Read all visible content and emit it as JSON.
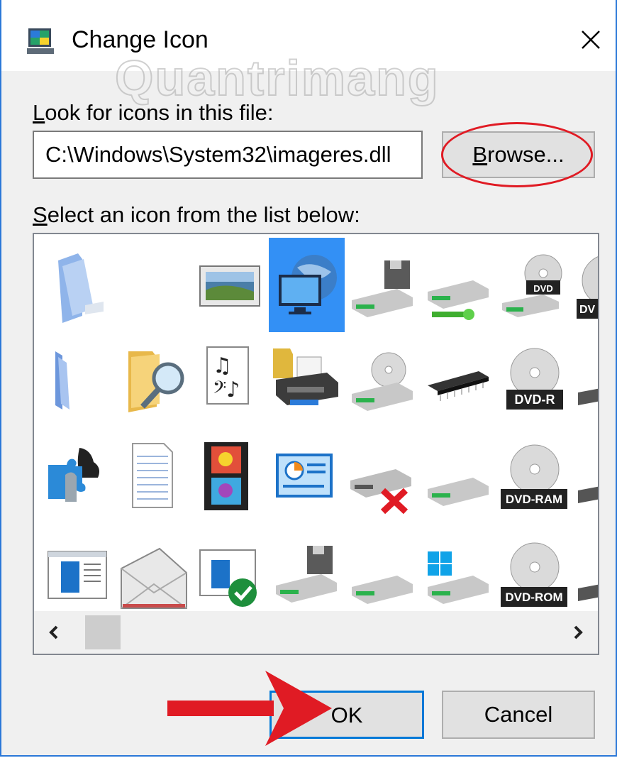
{
  "dialog": {
    "title": "Change Icon",
    "close_icon": "close-icon",
    "watermark": "Quantrimang"
  },
  "file": {
    "label_accel": "L",
    "label_rest": "ook for icons in this file:",
    "path_value": "C:\\Windows\\System32\\imageres.dll",
    "browse_accel": "B",
    "browse_rest": "rowse...",
    "browse_highlight_color": "#e01b24"
  },
  "list": {
    "label_accel": "S",
    "label_rest": "elect an icon from the list below:",
    "selected_index": 3,
    "selection_color": "#3390f5",
    "icons": [
      "folder-icon",
      "blank-icon",
      "picture-frame-icon",
      "network-monitor-icon",
      "floppy-drive-icon",
      "network-drive-icon",
      "dvd-drive-icon",
      "dvd-drive-icon",
      "folder-partial-icon",
      "folder-search-icon",
      "music-document-icon",
      "printer-icon",
      "cd-drive-icon",
      "memory-chip-icon",
      "dvd-r-drive-icon",
      "drive-partial-icon",
      "puzzle-chess-icon",
      "text-document-icon",
      "video-film-icon",
      "control-panel-icon",
      "drive-error-icon",
      "drive-icon",
      "dvd-ram-drive-icon",
      "drive-partial-icon",
      "window-document-icon",
      "envelope-icon",
      "window-check-icon",
      "floppy-drive-icon",
      "drive-icon",
      "windows-drive-icon",
      "dvd-rom-drive-icon",
      "drive-partial-icon"
    ],
    "disc_labels": [
      "DVD",
      "DV",
      "DVD-R",
      "DVD-RAM",
      "DVD-ROM"
    ]
  },
  "scrollbar": {
    "left_icon": "chevron-left-icon",
    "right_icon": "chevron-right-icon"
  },
  "buttons": {
    "ok_label": "OK",
    "cancel_label": "Cancel"
  },
  "annotation": {
    "arrow_icon": "red-arrow-icon",
    "arrow_color": "#e01b24"
  }
}
